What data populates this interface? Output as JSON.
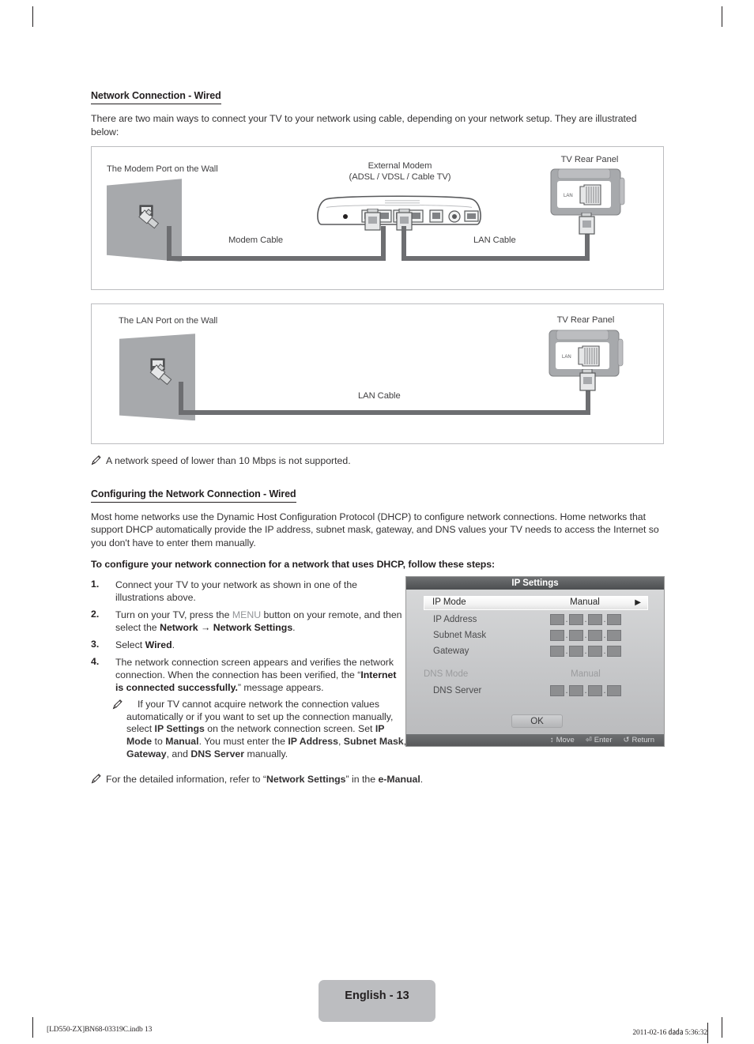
{
  "section1": {
    "heading": "Network Connection - Wired",
    "intro": "There are two main ways to connect your TV to your network using cable, depending on your network setup. They are illustrated below:"
  },
  "diagram1": {
    "wall_label": "The Modem Port on the Wall",
    "modem_label_line1": "External Modem",
    "modem_label_line2": "(ADSL / VDSL / Cable TV)",
    "tv_label": "TV Rear Panel",
    "modem_cable_label": "Modem Cable",
    "lan_cable_label": "LAN Cable",
    "port_label": "LAN"
  },
  "diagram2": {
    "wall_label": "The LAN Port on the Wall",
    "tv_label": "TV Rear Panel",
    "lan_cable_label": "LAN Cable",
    "port_label": "LAN"
  },
  "note1": "A network speed of lower than 10 Mbps is not supported.",
  "section2": {
    "heading": "Configuring the Network Connection - Wired",
    "para": "Most home networks use the Dynamic Host Configuration Protocol (DHCP) to configure network connections. Home networks that support DHCP automatically provide the IP address, subnet mask, gateway, and DNS values your TV needs to access the Internet so you don't have to enter them manually.",
    "lead": "To configure your network connection for a network that uses DHCP, follow these steps:"
  },
  "steps": [
    {
      "num": "1.",
      "text": "Connect your TV to your network as shown in one of the illustrations above."
    },
    {
      "num": "2.",
      "text_a": "Turn on your TV, press the ",
      "key": "MENU",
      "text_b": " button on your remote, and then select the ",
      "bold_a": "Network",
      "arrow": " → ",
      "bold_b": "Network Settings",
      "text_c": "."
    },
    {
      "num": "3.",
      "text_a": "Select ",
      "bold_a": "Wired",
      "text_b": "."
    },
    {
      "num": "4.",
      "text_a": "The network connection screen appears and verifies the network connection. When the connection has been verified, the “",
      "bold_a": "Internet is connected successfully.",
      "text_b": "” message appears."
    }
  ],
  "substep": {
    "t1": "If your TV cannot acquire network the connection values automatically or if you want to set up the connection manually, select ",
    "b1": "IP Settings",
    "t2": " on the network connection screen. Set ",
    "b2": "IP Mode",
    "t3": " to ",
    "b3": "Manual",
    "t4": ". You must enter the ",
    "b4": "IP Address",
    "t5": ", ",
    "b5": "Subnet Mask",
    "t6": ", ",
    "b6": "Gateway",
    "t7": ", and ",
    "b7": "DNS Server",
    "t8": " manually."
  },
  "note2": {
    "t1": "For the detailed information, refer to “",
    "b1": "Network Settings",
    "t2": "” in the ",
    "b2": "e-Manual",
    "t3": "."
  },
  "osd": {
    "title": "IP Settings",
    "rows": [
      {
        "label": "IP Mode",
        "value": "Manual",
        "type": "select",
        "highlight": true,
        "arrow": "▶"
      },
      {
        "label": "IP Address",
        "type": "octets",
        "octets": [
          "",
          "",
          "",
          ""
        ]
      },
      {
        "label": "Subnet Mask",
        "type": "octets",
        "octets": [
          "",
          "",
          "",
          ""
        ]
      },
      {
        "label": "Gateway",
        "type": "octets",
        "octets": [
          "",
          "",
          "",
          ""
        ]
      },
      {
        "label": "DNS Mode",
        "value": "Manual",
        "type": "text",
        "dim": true
      },
      {
        "label": "DNS Server",
        "type": "octets",
        "octets": [
          "",
          "",
          "",
          ""
        ]
      }
    ],
    "ok_label": "OK",
    "footer": [
      {
        "icon": "↕",
        "label": "Move"
      },
      {
        "icon": "⏎",
        "label": "Enter"
      },
      {
        "icon": "↺",
        "label": "Return"
      }
    ]
  },
  "page_footer": {
    "badge": "English - 13",
    "left": "[LD550-ZX]BN68-03319C.indb   13",
    "right": "2011-02-16   ㍲㍲ 5:36:32"
  }
}
